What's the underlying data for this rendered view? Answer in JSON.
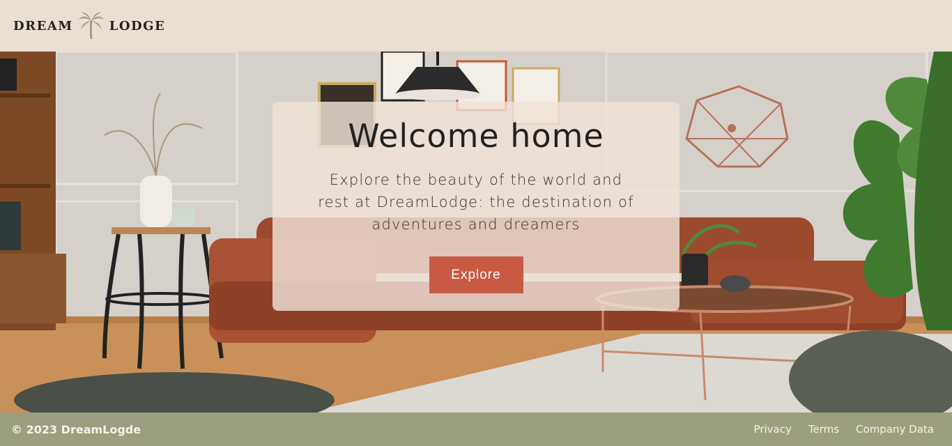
{
  "header": {
    "logo_left": "DREAM",
    "logo_right": "LODGE",
    "logo_icon": "palm-tree-icon"
  },
  "hero": {
    "title": "Welcome home",
    "text": "Explore the beauty of the world and rest at DreamLodge: the destination of adventures and dreamers",
    "button_label": "Explore"
  },
  "footer": {
    "copyright": "© 2023 DreamLogde",
    "links": [
      "Privacy",
      "Terms",
      "Company Data"
    ]
  },
  "colors": {
    "header_bg": "#ebdfd4",
    "button": "#c85a44",
    "footer_bg": "#9b9f7f",
    "sofa": "#9b4a2e"
  }
}
